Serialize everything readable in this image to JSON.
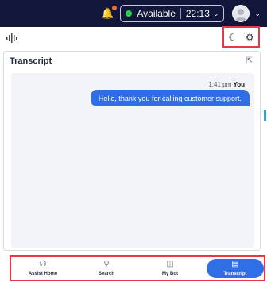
{
  "header": {
    "status_label": "Available",
    "timer": "22:13",
    "icons": {
      "notifications": "bell-alert-icon",
      "avatar": "user-avatar-icon"
    }
  },
  "toolbar": {
    "left_icon": "voice-wave-icon",
    "dark_mode_icon": "moon-icon",
    "settings_icon": "gear-icon"
  },
  "transcript": {
    "title": "Transcript",
    "messages": [
      {
        "time": "1:41 pm",
        "speaker": "You",
        "text": "Hello, thank you for calling customer support."
      }
    ]
  },
  "bottom_nav": {
    "items": [
      {
        "label": "Assist Home",
        "icon": "assist-home-icon"
      },
      {
        "label": "Search",
        "icon": "search-icon"
      },
      {
        "label": "My Bot",
        "icon": "bot-icon"
      },
      {
        "label": "Transcript",
        "icon": "transcript-icon",
        "active": true
      }
    ]
  },
  "colors": {
    "header_bg": "#12163a",
    "accent": "#2f6fe6",
    "highlight_border": "#e53946",
    "status_dot": "#2ecc55"
  }
}
